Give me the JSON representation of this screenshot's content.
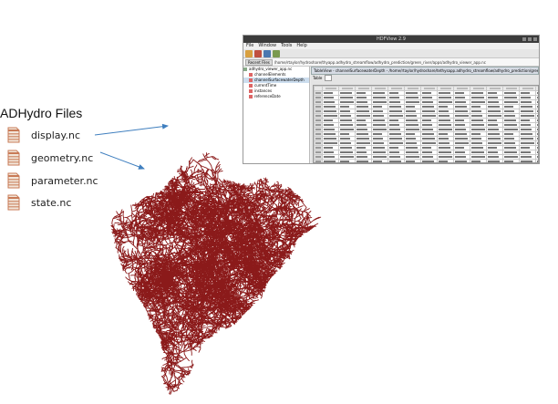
{
  "heading": "ADHydro Files",
  "files": [
    {
      "name": "display.nc",
      "icon": "document-icon"
    },
    {
      "name": "geometry.nc",
      "icon": "document-icon"
    },
    {
      "name": "parameter.nc",
      "icon": "document-icon"
    },
    {
      "name": "state.nc",
      "icon": "document-icon"
    }
  ],
  "colors": {
    "river": "#8b1a1a",
    "file_icon": "#c87a56",
    "arrow": "#3f7fbf",
    "titlebar": "#3b3b3b"
  },
  "viewer": {
    "title": "HDFView 2.9",
    "menu": [
      "File",
      "Window",
      "Tools",
      "Help"
    ],
    "recent_label": "Recent Files",
    "path": "/home/rtaylor/hydroshare/thyapp.adhydro_streamflow/adhydro_prediction/green_river/apps/adhydro_viewer_app.nc",
    "tree_root": "adhydro_viewer_app.nc",
    "tree_items": [
      "channelElements",
      "channelSurfacewaterDepth",
      "currentTime",
      "instances",
      "referenceDate"
    ],
    "tree_selected": 1,
    "panel_title": "TableView - channelSurfacewaterDepth - /home/rtaylor/hydroshare/tethysapp.adhydro_streamflow/adhydro_prediction/green_river/apps/adhydro_viewer_app.nc",
    "table_label": "Table"
  }
}
